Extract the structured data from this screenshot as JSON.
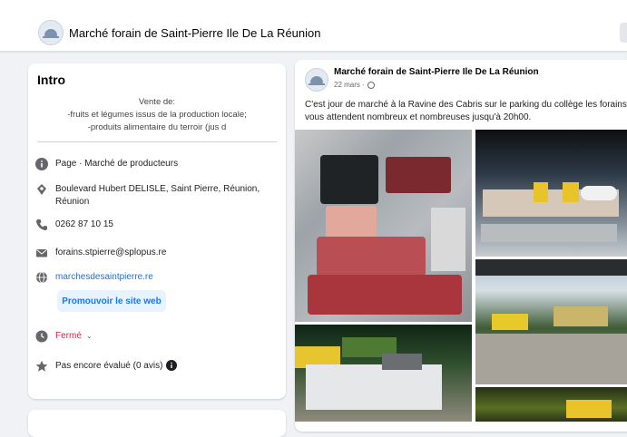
{
  "page": {
    "title": "Marché forain de Saint-Pierre Ile De La Réunion"
  },
  "intro": {
    "heading": "Intro",
    "bio": [
      "Vente de:",
      "-fruits et légumes issus de la production locale;",
      "-produits alimentaire du terroir (jus d"
    ],
    "category_type": "Page",
    "category_value": " · Marché de producteurs",
    "address": "Boulevard Hubert DELISLE, Saint Pierre, Réunion, Réunion",
    "phone": "0262 87 10 15",
    "email": "forains.stpierre@splopus.re",
    "website": "marchesdesaintpierre.re",
    "promote_label": "Promouvoir le site web",
    "hours_status": "Fermé",
    "rating": "Pas encore évalué (0 avis)",
    "icons": [
      "info-icon",
      "location-pin-icon",
      "phone-icon",
      "mail-icon",
      "globe-icon",
      "clock-icon",
      "star-icon"
    ]
  },
  "post": {
    "author": "Marché forain de Saint-Pierre Ile De La Réunion",
    "time": "22 mars",
    "text": "C'est jour de marché à la Ravine des Cabris sur le parking du collège les forains vous attendent nombreux et nombreuses jusqu'à 20h00."
  },
  "colors": {
    "link": "#216fdb",
    "accent": "#1877f2",
    "closed": "#e41e3f",
    "background": "#f0f2f5"
  }
}
